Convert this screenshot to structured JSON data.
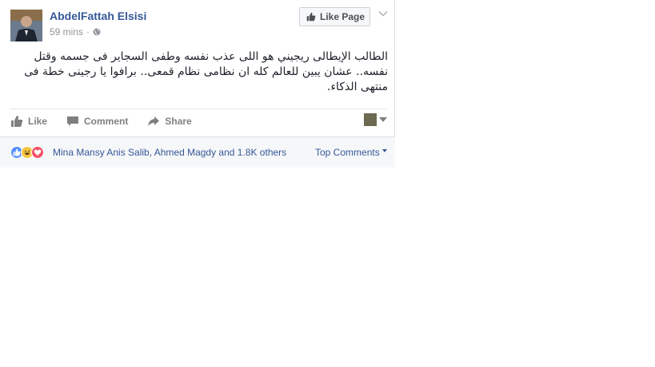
{
  "post": {
    "author": "AbdelFattah Elsisi",
    "time": "59 mins",
    "separator": "·",
    "like_page_label": "Like Page",
    "text": "الطالب الإيطالى ريجيني هو اللى عذب نفسه وطفى السجاير فى جسمه وقتل نفسه.. عشان يبين للعالم كله ان نظامى نظام قمعى.. برافوا يا رجينى خطة فى منتهى الذكاء."
  },
  "actions": {
    "like": "Like",
    "comment": "Comment",
    "share": "Share"
  },
  "footer": {
    "reactions_text": "Mina Mansy Anis Salib, Ahmed Magdy and 1.8K others",
    "top_comments": "Top Comments"
  },
  "colors": {
    "link": "#365899",
    "muted": "#90949c",
    "like_reaction": "#5890ff",
    "haha_reaction": "#f7c543",
    "love_reaction": "#f25268"
  }
}
